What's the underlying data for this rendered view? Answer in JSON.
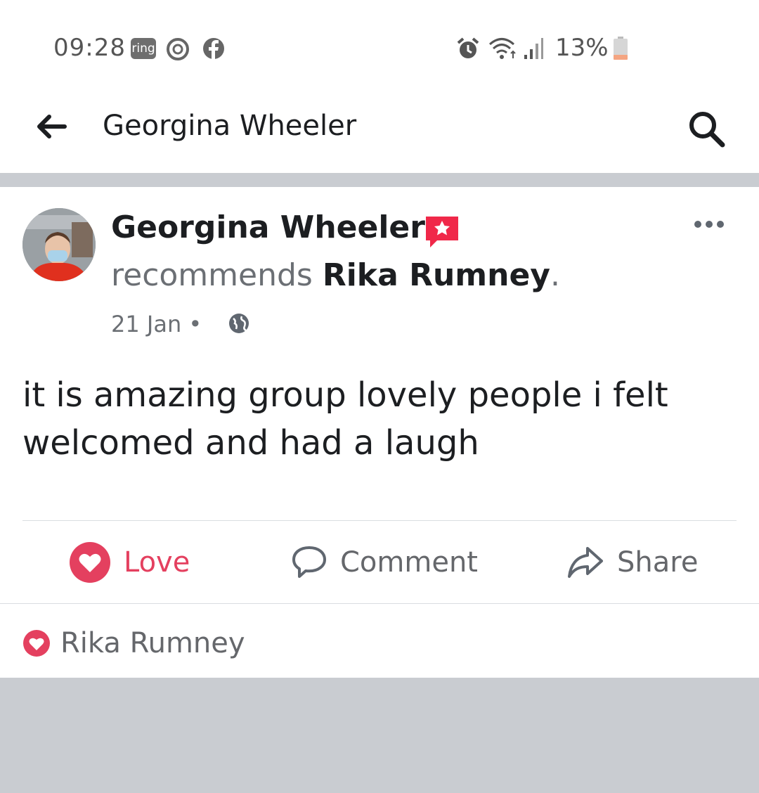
{
  "status_bar": {
    "time": "09:28",
    "ring_label": "ring",
    "battery": "13%"
  },
  "header": {
    "title": "Georgina Wheeler"
  },
  "post": {
    "author": "Georgina Wheeler",
    "recommends_text": "recommends",
    "page_name": "Rika Rumney",
    "punct": ".",
    "date": "21 Jan",
    "separator": "•",
    "body": "it is amazing group lovely people i felt welcomed and had a laugh",
    "actions": {
      "love": "Love",
      "comment": "Comment",
      "share": "Share"
    },
    "reaction_names": "Rika Rumney"
  },
  "colors": {
    "love": "#e4405f",
    "background": "#c9ccd1"
  },
  "icons": [
    "ring-icon",
    "alexa-icon",
    "facebook-icon",
    "alarm-icon",
    "wifi-icon",
    "signal-icon",
    "battery-icon",
    "back-arrow-icon",
    "search-icon",
    "recommend-badge-icon",
    "more-icon",
    "globe-icon",
    "love-icon",
    "comment-icon",
    "share-icon"
  ]
}
